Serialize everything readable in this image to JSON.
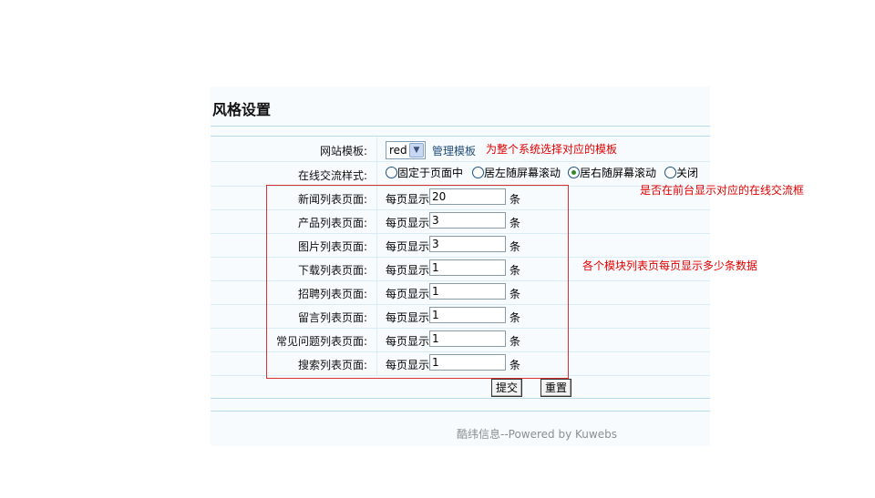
{
  "page": {
    "title": "风格设置",
    "footer": "酷纬信息--Powered by Kuwebs"
  },
  "template_row": {
    "label": "网站模板:",
    "selected": "red",
    "manage_link": "管理模板"
  },
  "chat_row": {
    "label": "在线交流样式:",
    "options": [
      {
        "label": "固定于页面中",
        "checked": false
      },
      {
        "label": "居左随屏幕滚动",
        "checked": false
      },
      {
        "label": "居右随屏幕滚动",
        "checked": true
      },
      {
        "label": "关闭",
        "checked": false
      }
    ]
  },
  "list_rows": [
    {
      "label": "新闻列表页面:",
      "prefix": "每页显示",
      "value": "20",
      "unit": "条"
    },
    {
      "label": "产品列表页面:",
      "prefix": "每页显示",
      "value": "3",
      "unit": "条"
    },
    {
      "label": "图片列表页面:",
      "prefix": "每页显示",
      "value": "3",
      "unit": "条"
    },
    {
      "label": "下载列表页面:",
      "prefix": "每页显示",
      "value": "1",
      "unit": "条"
    },
    {
      "label": "招聘列表页面:",
      "prefix": "每页显示",
      "value": "1",
      "unit": "条"
    },
    {
      "label": "留言列表页面:",
      "prefix": "每页显示",
      "value": "1",
      "unit": "条"
    },
    {
      "label": "常见问题列表页面:",
      "prefix": "每页显示",
      "value": "1",
      "unit": "条"
    },
    {
      "label": "搜索列表页面:",
      "prefix": "每页显示",
      "value": "1",
      "unit": "条"
    }
  ],
  "buttons": {
    "submit": "提交",
    "reset": "重置"
  },
  "notes": {
    "template": "为整个系统选择对应的模板",
    "chat": "是否在前台显示对应的在线交流框",
    "list": "各个模块列表页每页显示多少条数据"
  },
  "colors": {
    "annotation": "#e00000",
    "panel_bg": "#f7fbfd",
    "link": "#1f4e79"
  }
}
